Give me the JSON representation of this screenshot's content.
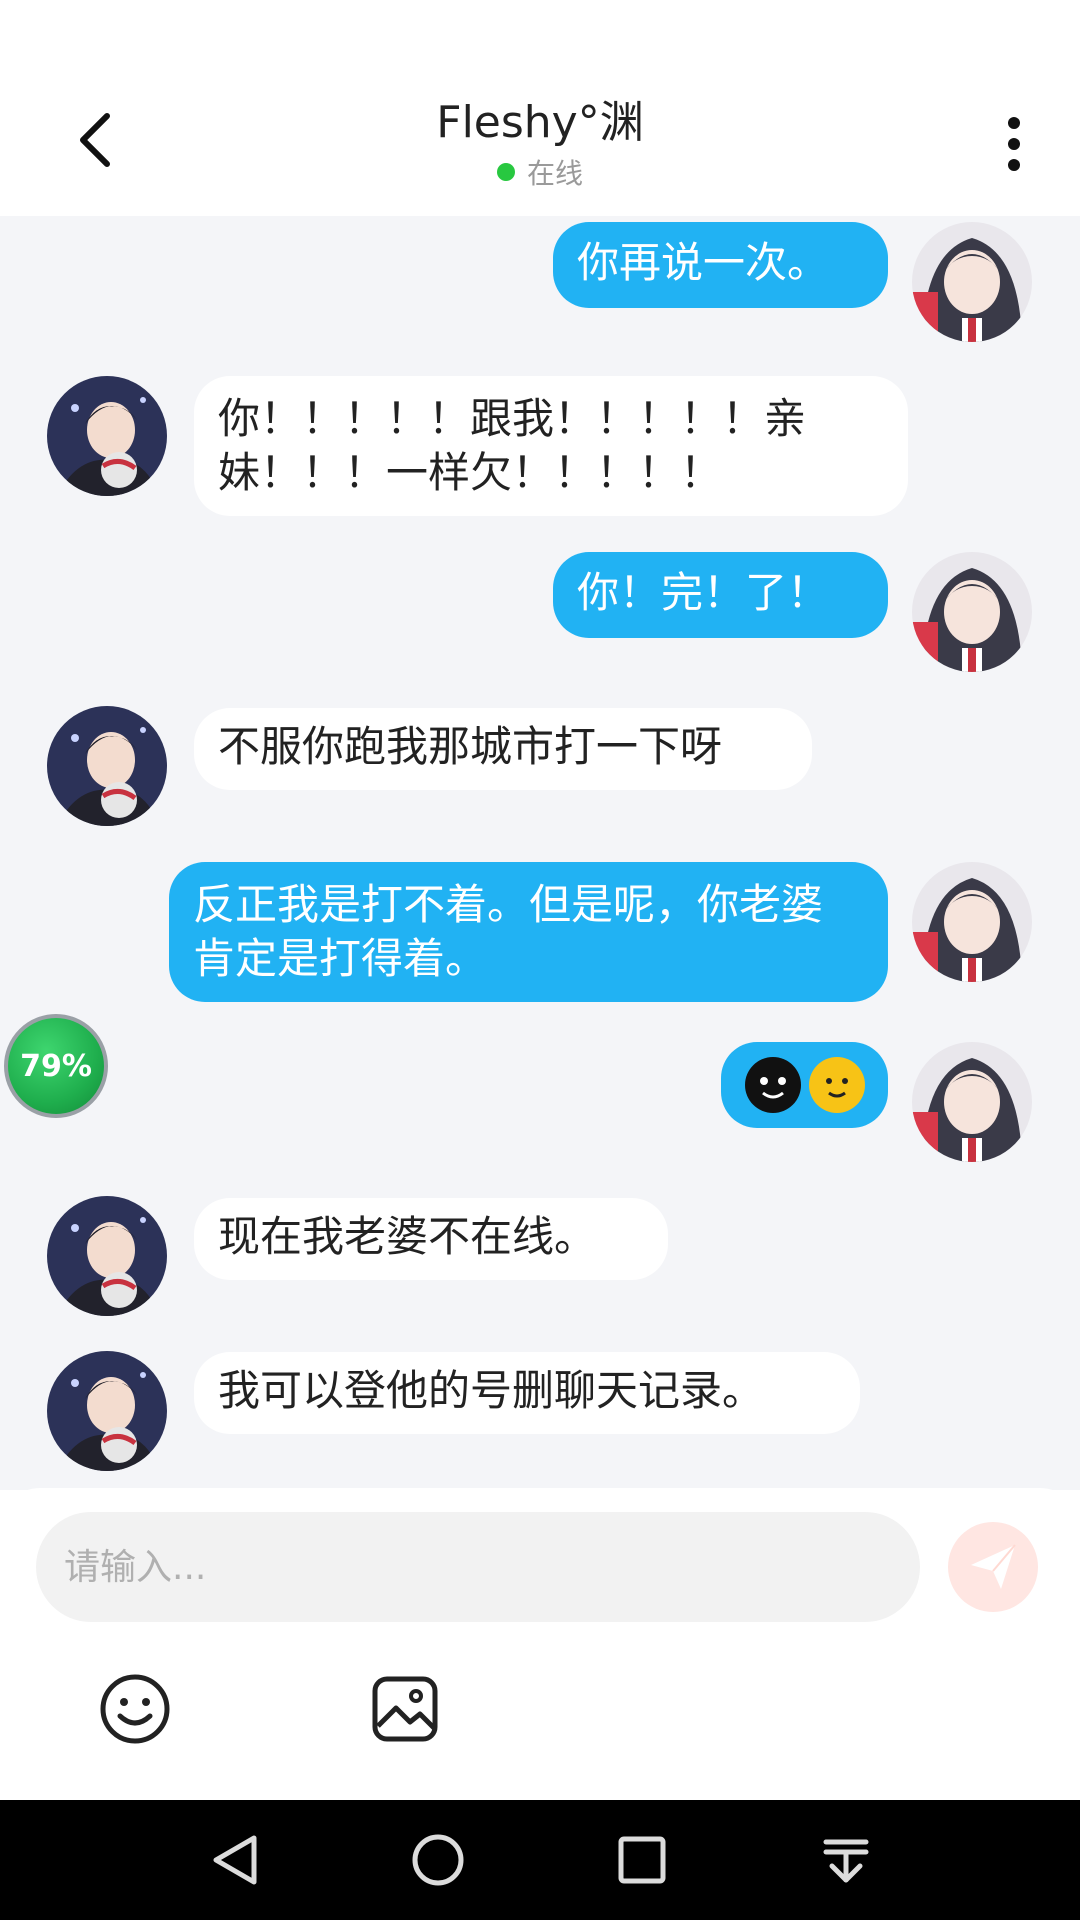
{
  "header": {
    "title": "Fleshy°渊",
    "status_text": "在线"
  },
  "messages": [
    {
      "sender": "me",
      "text": "你再说一次。"
    },
    {
      "sender": "other",
      "text": "你！！！！！跟我！！！！！亲妹！！！一样欠！！！！！"
    },
    {
      "sender": "me",
      "text": "你！完！了！"
    },
    {
      "sender": "other",
      "text": "不服你跑我那城市打一下呀"
    },
    {
      "sender": "me",
      "text": "反正我是打不着。但是呢，你老婆肯定是打得着。"
    },
    {
      "sender": "me",
      "text": "",
      "emoji": [
        "black-face-emoji",
        "yellow-face-emoji"
      ]
    },
    {
      "sender": "other",
      "text": "现在我老婆不在线。"
    },
    {
      "sender": "other",
      "text": "我可以登他的号删聊天记录。"
    }
  ],
  "floating_badge": {
    "percent_text": "79%"
  },
  "input": {
    "placeholder": "请输入..."
  },
  "colors": {
    "my_bubble": "#21b2f3",
    "other_bubble": "#ffffff",
    "chat_background": "#f4f5f8",
    "online_dot": "#28c840",
    "send_button_bg": "#ffe6e2"
  },
  "icons": {
    "back": "chevron-left-icon",
    "more": "more-vertical-icon",
    "send": "paper-plane-icon",
    "emoji": "smiley-icon",
    "image": "image-icon",
    "nav": [
      "back-triangle-icon",
      "home-circle-icon",
      "recents-square-icon",
      "notification-pull-icon"
    ]
  }
}
